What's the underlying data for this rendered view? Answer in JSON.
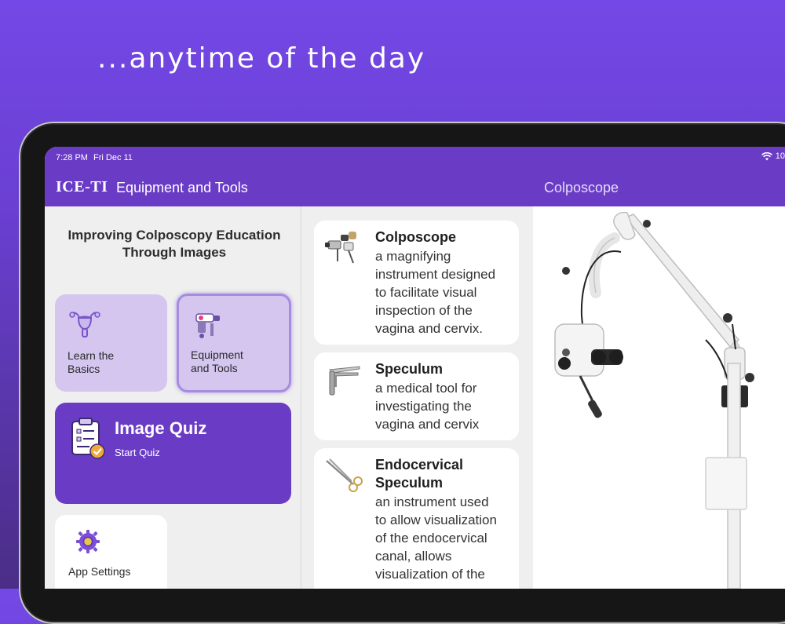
{
  "tagline": "...anytime of the day",
  "status": {
    "time": "7:28 PM",
    "date": "Fri Dec 11",
    "battery": "10"
  },
  "nav": {
    "logo": "ICE-TI",
    "title": "Equipment and Tools",
    "detail_title": "Colposcope"
  },
  "sidebar": {
    "heading_line1": "Improving Colposcopy Education",
    "heading_line2": "Through Images",
    "tiles": [
      {
        "label_line1": "Learn the",
        "label_line2": "Basics",
        "icon": "uterus-icon"
      },
      {
        "label_line1": "Equipment",
        "label_line2": "and Tools",
        "icon": "colposcope-icon"
      }
    ],
    "quiz": {
      "title": "Image Quiz",
      "subtitle": "Start Quiz",
      "icon": "clipboard-check-icon"
    },
    "settings": {
      "label": "App Settings",
      "icon": "gear-icon"
    }
  },
  "list": {
    "items": [
      {
        "title": "Colposcope",
        "desc_lines": [
          "a magnifying",
          "instrument designed",
          "to facilitate visual",
          "inspection of the",
          "vagina and cervix."
        ]
      },
      {
        "title": "Speculum",
        "desc_lines": [
          "a medical tool for",
          "investigating the",
          "vagina and cervix"
        ]
      },
      {
        "title_line1": "Endocervical",
        "title_line2": "Speculum",
        "desc_lines": [
          "an instrument used",
          "to allow visualization",
          "of the endocervical",
          "canal, allows",
          "visualization of the"
        ]
      }
    ]
  },
  "colors": {
    "brand": "#6a3cc6",
    "tile": "#d4c6ef",
    "background": "#7448e6"
  }
}
